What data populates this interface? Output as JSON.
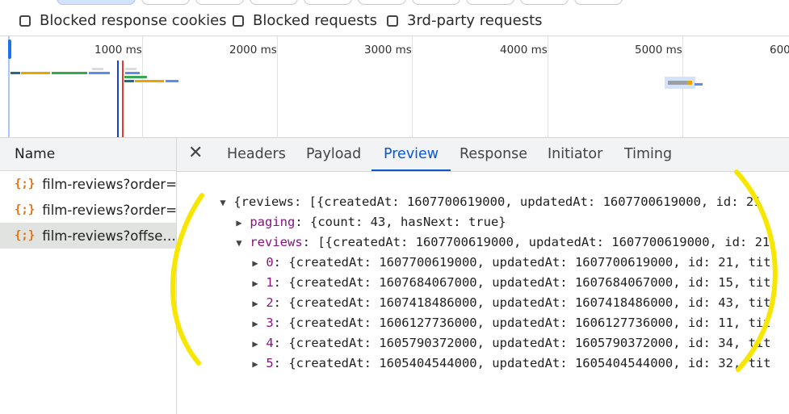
{
  "filters": {
    "blocked_cookies": "Blocked response cookies",
    "blocked_requests": "Blocked requests",
    "third_party": "3rd-party requests"
  },
  "timeline": {
    "ticks": [
      "1000 ms",
      "2000 ms",
      "3000 ms",
      "4000 ms",
      "5000 ms",
      "600"
    ]
  },
  "name_column": {
    "header": "Name",
    "rows": [
      "film-reviews?order=",
      "film-reviews?order=",
      "film-reviews?offse…"
    ],
    "icon_glyph": "{;}"
  },
  "tabs": {
    "close": "✕",
    "items": [
      "Headers",
      "Payload",
      "Preview",
      "Response",
      "Initiator",
      "Timing"
    ],
    "active": "Preview"
  },
  "preview": {
    "root": {
      "triangle": "▼",
      "text": "{reviews: [{createdAt: 1607700619000, updatedAt: 1607700619000, id: 21"
    },
    "paging": {
      "triangle": "▶",
      "key": "paging",
      "rest": ": {count: 43, hasNext: true}"
    },
    "reviews": {
      "triangle": "▼",
      "key": "reviews",
      "rest": ": [{createdAt: 1607700619000, updatedAt: 1607700619000, id: 21"
    },
    "items": [
      {
        "key": "0",
        "rest": ": {createdAt: 1607700619000, updatedAt: 1607700619000, id: 21, tit"
      },
      {
        "key": "1",
        "rest": ": {createdAt: 1607684067000, updatedAt: 1607684067000, id: 15, tit"
      },
      {
        "key": "2",
        "rest": ": {createdAt: 1607418486000, updatedAt: 1607418486000, id: 43, tit"
      },
      {
        "key": "3",
        "rest": ": {createdAt: 1606127736000, updatedAt: 1606127736000, id: 11, tit"
      },
      {
        "key": "4",
        "rest": ": {createdAt: 1605790372000, updatedAt: 1605790372000, id: 34, tit"
      },
      {
        "key": "5",
        "rest": ": {createdAt: 1605404544000, updatedAt: 1605404544000, id: 32, tit"
      }
    ],
    "collapsed_triangle": "▶"
  },
  "colors": {
    "accent": "#0b57d0",
    "key": "#881280",
    "annotation": "#f7e600",
    "file_icon": "#e8710a"
  }
}
